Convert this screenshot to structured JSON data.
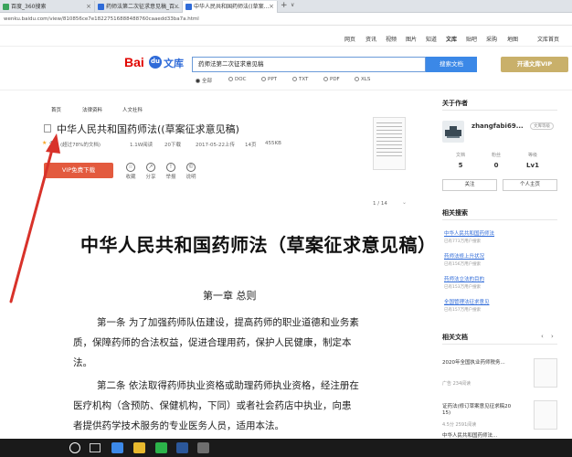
{
  "browser": {
    "tabs": [
      {
        "label": "百度_360搜索",
        "active": false
      },
      {
        "label": "药师法第二次征求意见稿_百...",
        "active": false
      },
      {
        "label": "中华人民共和国药师法((草案...",
        "active": true
      }
    ],
    "new_tab": "+",
    "url": "wenku.baidu.com/view/810856ce7e18227516888488760caaedd33ba7a.html"
  },
  "topnav": {
    "links": [
      "网页",
      "资讯",
      "视频",
      "图片",
      "知道",
      "文库",
      "贴吧",
      "采购",
      "地图"
    ],
    "right_link": "文库首页"
  },
  "search": {
    "logo_bai": "Bai",
    "logo_du": "du",
    "logo_wenku": "文库",
    "query": "药师法第二次征求意见稿",
    "button": "搜索文档",
    "vip_button": "开通文库VIP",
    "filetypes": [
      "全部",
      "DOC",
      "PPT",
      "TXT",
      "PDF",
      "XLS"
    ]
  },
  "breadcrumb": [
    "首页",
    "法律资料",
    "人文社科"
  ],
  "doc": {
    "title": "中华人民共和国药师法((草案征求意见稿)",
    "rating": "4.5",
    "rating_note": "(超过78%的文档)",
    "views": "1.1W阅读",
    "downloads": "20下载",
    "date": "2017-05-22上传",
    "pages": "14页",
    "size": "455KB",
    "vip_button": "VIP免费下载",
    "actions": [
      "收藏",
      "分享",
      "举报",
      "说明"
    ],
    "pager": "1 / 14"
  },
  "content": {
    "main_title": "中华人民共和国药师法（草案征求意见稿）",
    "chapter": "第一章  总则",
    "paragraphs": [
      "第一条  为了加强药师队伍建设，提高药师的职业道德和业务素",
      "质，保障药师的合法权益，促进合理用药，保护人民健康，制定本",
      "法。",
      "第二条  依法取得药师执业资格或助理药师执业资格，经注册在",
      "医疗机构（含预防、保健机构，下同）或者社会药店中执业，向患",
      "者提供药学技术服务的专业医务人员，适用本法。"
    ]
  },
  "sidebar": {
    "author_heading": "关于作者",
    "author_name": "zhangfabi69...",
    "author_badge": "文库等级",
    "stats": [
      {
        "label": "文档",
        "value": "5"
      },
      {
        "label": "粉丝",
        "value": "0"
      },
      {
        "label": "等级",
        "value": "Lv1"
      }
    ],
    "follow": "关注",
    "homepage": "个人主页",
    "related_search_heading": "相关搜索",
    "related_searches": [
      {
        "label": "中华人民共和国药师法",
        "sub": "已有773万用户搜索"
      },
      {
        "label": "药师法修上升状况",
        "sub": "已有156万用户搜索"
      },
      {
        "label": "药师法立法的目的",
        "sub": "已有153万用户搜索"
      },
      {
        "label": "全国管理法征求意见",
        "sub": "已有157万用户搜索"
      }
    ],
    "related_docs_heading": "相关文档",
    "related_docs": [
      {
        "title": "2020年全国执业药师税务...",
        "meta": "广告      234阅读"
      },
      {
        "title": "证药法(修订草案意见征求稿20",
        "sub": "15)",
        "meta": "4.5分      2591阅读"
      },
      {
        "title": "中华人民共和国药师法..."
      }
    ]
  },
  "colors": {
    "brand_red": "#e10601",
    "brand_blue": "#2f6bd8",
    "vip_gold": "#c9b06a",
    "download_red": "#e35a3e",
    "annotation_arrow": "#d8322a"
  }
}
